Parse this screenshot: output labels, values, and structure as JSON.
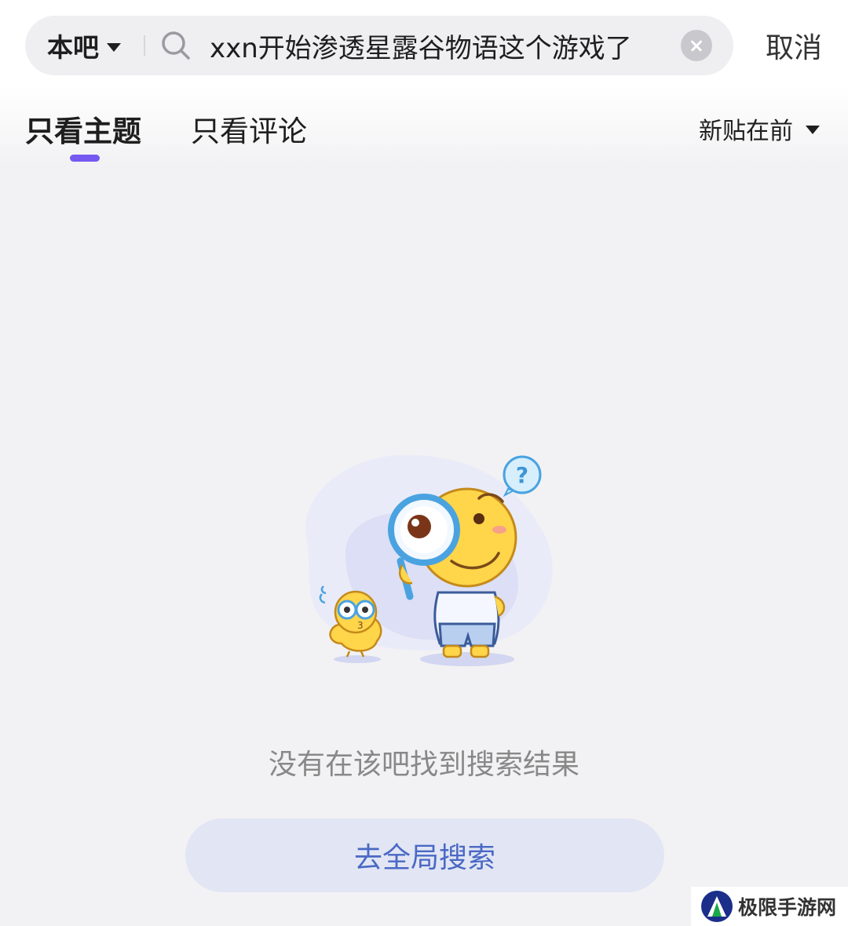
{
  "search": {
    "scope_label": "本吧",
    "query": "xxn开始渗透星露谷物语这个游戏了",
    "cancel_label": "取消"
  },
  "tabs": [
    {
      "label": "只看主题",
      "active": true
    },
    {
      "label": "只看评论",
      "active": false
    }
  ],
  "sort": {
    "label": "新贴在前"
  },
  "empty_state": {
    "message": "没有在该吧找到搜索结果",
    "button_label": "去全局搜索"
  },
  "watermark": {
    "text": "极限手游网"
  },
  "colors": {
    "accent": "#7559f0",
    "button_bg": "#e2e5f4",
    "button_text": "#4a69c4",
    "background": "#f2f2f4"
  }
}
